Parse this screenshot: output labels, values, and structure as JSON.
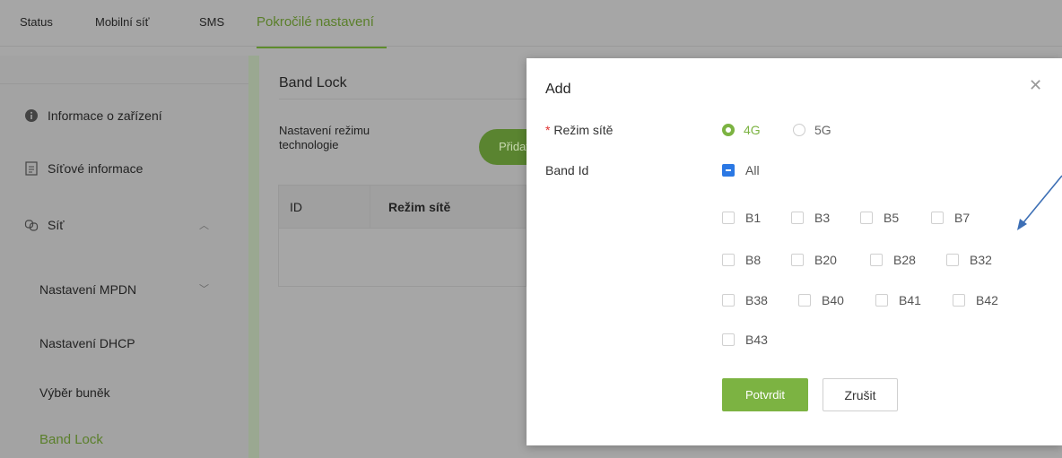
{
  "topnav": {
    "tabs": [
      {
        "label": "Status"
      },
      {
        "label": "Mobilní síť"
      },
      {
        "label": "SMS"
      },
      {
        "label": "Pokročilé nastavení"
      }
    ]
  },
  "sidebar": {
    "items": [
      {
        "label": "Informace o zařízení",
        "icon": "info-icon"
      },
      {
        "label": "Síťové informace",
        "icon": "document-icon"
      },
      {
        "label": "Síť",
        "icon": "network-icon"
      }
    ],
    "subitems": [
      {
        "label": "Nastavení MPDN"
      },
      {
        "label": "Nastavení DHCP"
      },
      {
        "label": "Výběr buněk"
      },
      {
        "label": "Band Lock"
      }
    ]
  },
  "main": {
    "heading": "Band Lock",
    "mode_label": "Nastavení režimu technologie",
    "add_button": "Přidat",
    "table": {
      "columns": [
        "ID",
        "Režim sítě"
      ]
    }
  },
  "modal": {
    "title": "Add",
    "network_mode_label": "Režim sítě",
    "network_mode_options": [
      {
        "label": "4G",
        "checked": true
      },
      {
        "label": "5G",
        "checked": false
      }
    ],
    "band_id_label": "Band Id",
    "all_label": "All",
    "bands": [
      "B1",
      "B3",
      "B5",
      "B7",
      "B8",
      "B20",
      "B28",
      "B32",
      "B38",
      "B40",
      "B41",
      "B42",
      "B43"
    ],
    "confirm_label": "Potvrdit",
    "cancel_label": "Zrušit"
  },
  "colors": {
    "accent": "#7cb342",
    "checkbox_blue": "#2b78e4",
    "annotation_arrow": "#3d6fb5"
  }
}
